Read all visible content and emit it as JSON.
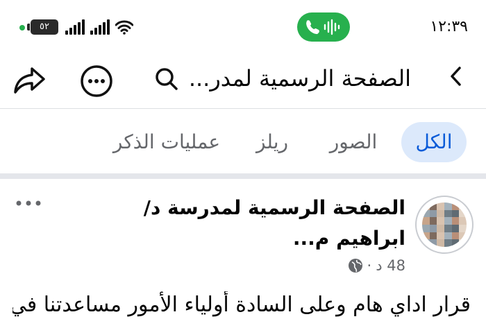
{
  "status_bar": {
    "time": "١٢:٣٩",
    "battery": "٥٢",
    "accent_green": "#27b04e"
  },
  "header": {
    "title": "الصفحة الرسمية لمدر...",
    "icons": [
      "chevron-left-icon",
      "search-icon",
      "more-icon",
      "share-icon"
    ]
  },
  "tabs": [
    {
      "label": "الكل",
      "selected": true
    },
    {
      "label": "الصور",
      "selected": false
    },
    {
      "label": "ريلز",
      "selected": false
    },
    {
      "label": "عمليات الذكر",
      "selected": false
    }
  ],
  "post": {
    "author": "الصفحة الرسمية لمدرسة د/ابراهيم م...",
    "time": "48 د",
    "separator": "·",
    "privacy": "globe-icon",
    "text": "قرار اداي هام وعلى السادة أولياء الأمور مساعدتنا في"
  },
  "colors": {
    "selected_tab_bg": "#dce9fb",
    "selected_tab_text": "#0a5bd8",
    "secondary_text": "#65676b"
  }
}
